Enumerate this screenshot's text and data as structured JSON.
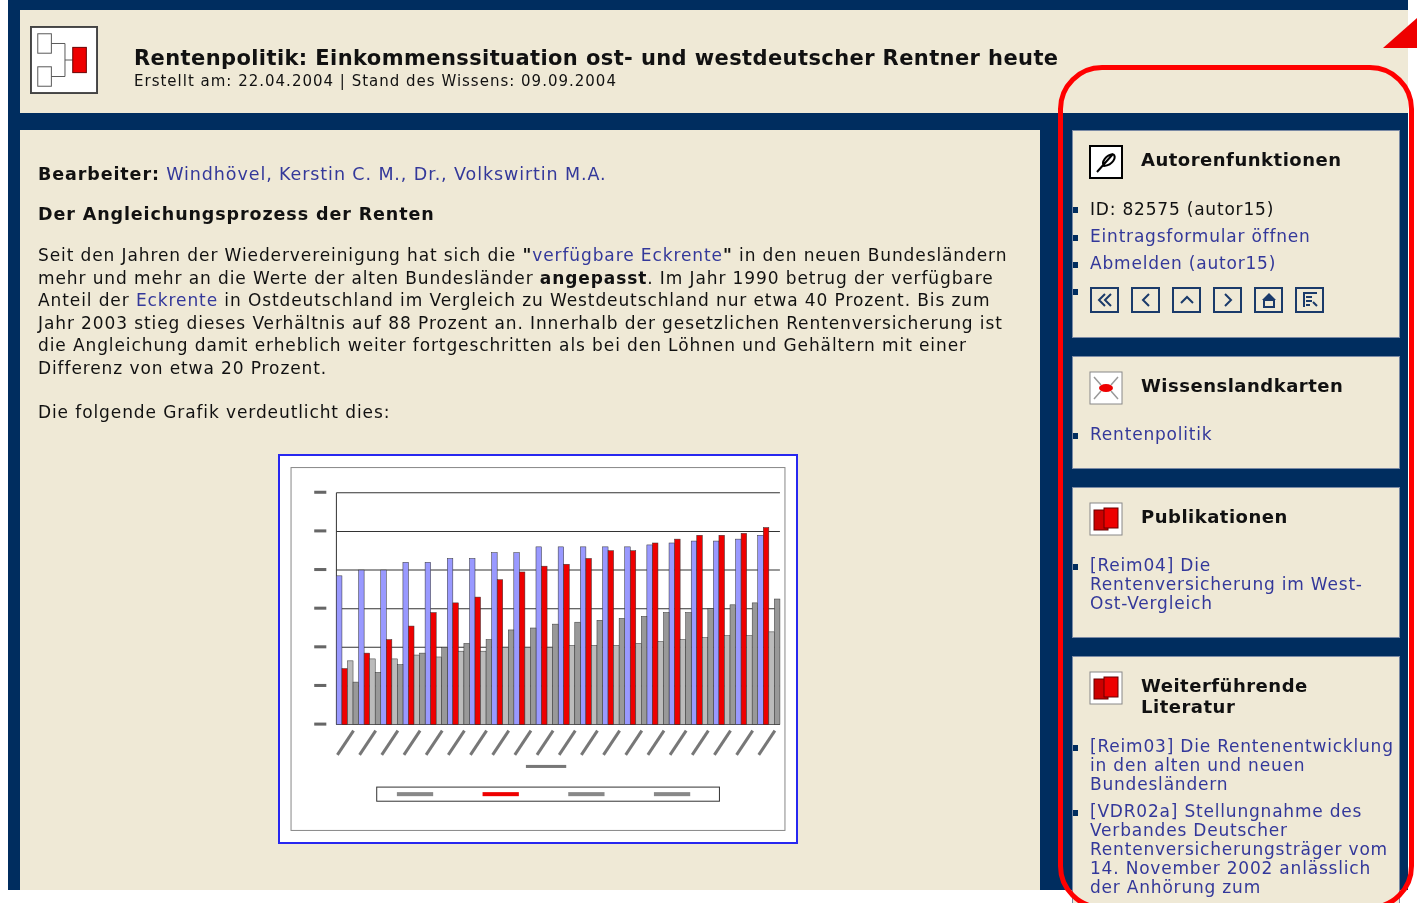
{
  "header": {
    "title": "Rentenpolitik: Einkommenssituation ost- und westdeutscher Rentner heute",
    "subtitle": "Erstellt am: 22.04.2004 | Stand des Wissens: 09.09.2004"
  },
  "content": {
    "editor_label": "Bearbeiter:",
    "editor_link": "Windhövel, Kerstin C. M., Dr., Volkswirtin M.A.",
    "heading": "Der Angleichungsprozess der Renten",
    "paragraph": [
      {
        "kind": "text",
        "text": "Seit den Jahren der Wiedervereinigung hat sich die "
      },
      {
        "kind": "bold",
        "text": "\""
      },
      {
        "kind": "link",
        "text": "verfügbare Eckrente"
      },
      {
        "kind": "bold",
        "text": "\""
      },
      {
        "kind": "text",
        "text": " in den neuen Bundesländern mehr und mehr an die Werte der alten Bundesländer "
      },
      {
        "kind": "bold",
        "text": "angepasst"
      },
      {
        "kind": "text",
        "text": ". Im Jahr 1990 betrug der verfügbare Anteil der "
      },
      {
        "kind": "link",
        "text": "Eckrente"
      },
      {
        "kind": "text",
        "text": " in Ostdeutschland im Vergleich zu Westdeutschland nur etwa 40 Prozent. Bis zum Jahr 2003 stieg dieses Verhältnis auf 88 Prozent an. Innerhalb der gesetzlichen Rentenversicherung ist die Angleichung damit erheblich weiter fortgeschritten als bei den Löhnen und Gehältern mit einer Differenz von etwa 20 Prozent."
      }
    ],
    "chart_intro": "Die folgende Grafik verdeutlicht dies:"
  },
  "sidebar": [
    {
      "kind": "author",
      "title": "Autorenfunktionen",
      "items": [
        {
          "kind": "text",
          "text": "ID: 82575 (autor15)"
        },
        {
          "kind": "link",
          "text": "Eintragsformular öffnen"
        },
        {
          "kind": "link",
          "text": "Abmelden (autor15)"
        },
        {
          "kind": "nav"
        }
      ]
    },
    {
      "kind": "maps",
      "title": "Wissenslandkarten",
      "items": [
        {
          "kind": "link",
          "text": "Rentenpolitik"
        }
      ]
    },
    {
      "kind": "publications",
      "title": "Publikationen",
      "items": [
        {
          "kind": "link",
          "text": "[Reim04] Die Rentenversicherung im West-Ost-Vergleich"
        }
      ]
    },
    {
      "kind": "literature",
      "title": "Weiterführende Literatur",
      "items": [
        {
          "kind": "link",
          "text": "[Reim03] Die Rentenentwicklung in den alten und neuen Bundesländern"
        },
        {
          "kind": "link",
          "text": "[VDR02a] Stellungnahme des Verbandes Deutscher Rentenversicherungsträger vom 14. November 2002 anlässlich der Anhörung zum"
        }
      ]
    }
  ]
}
